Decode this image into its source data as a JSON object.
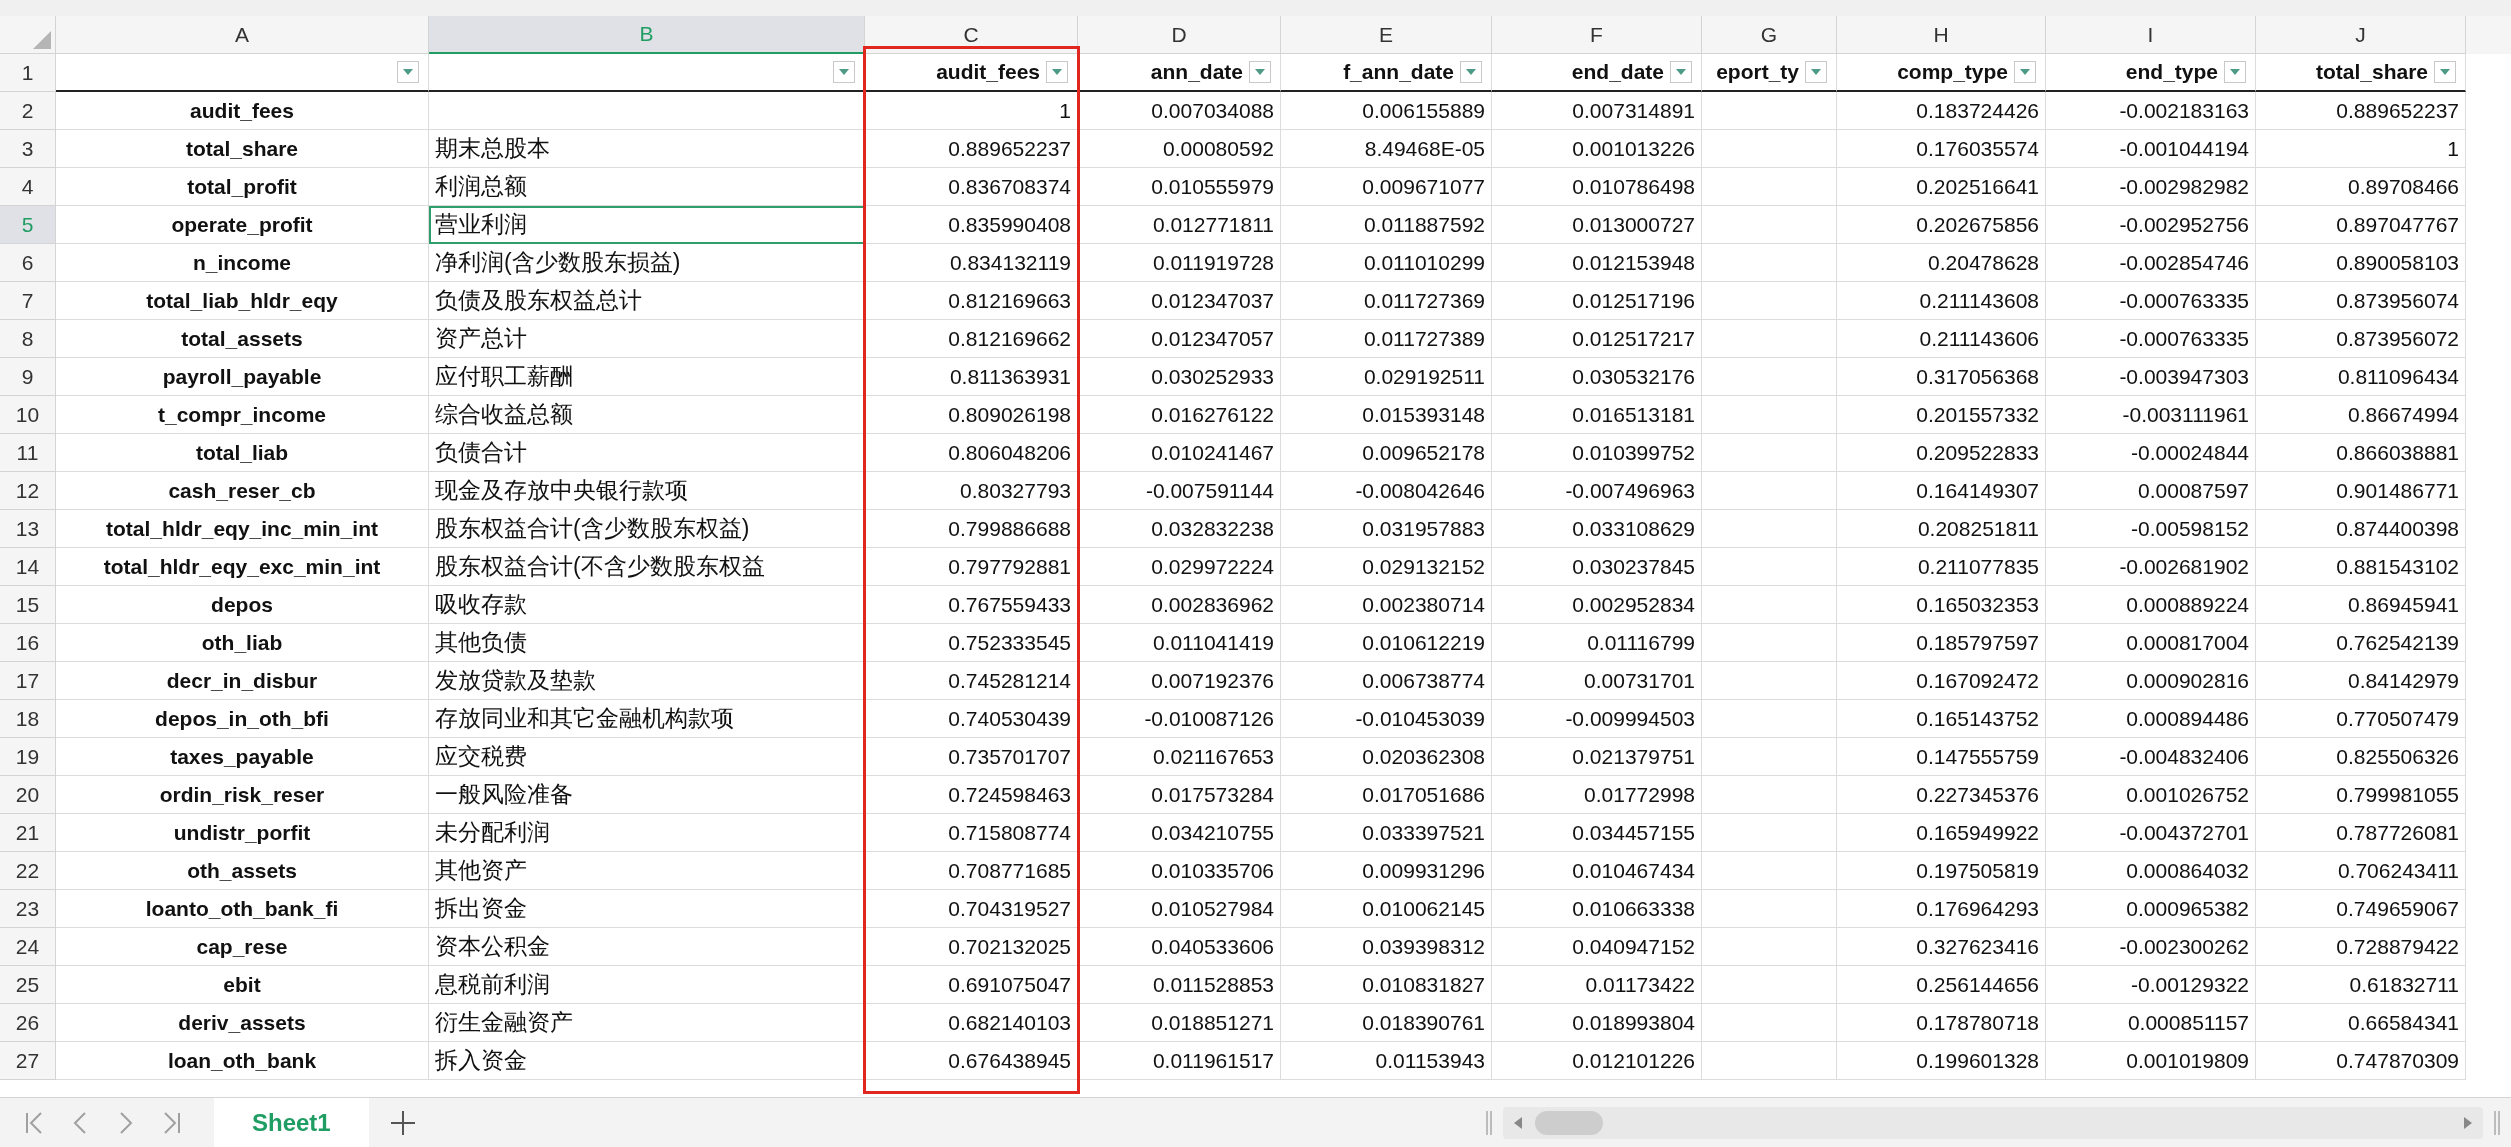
{
  "columns": [
    {
      "letter": "A",
      "selected": false
    },
    {
      "letter": "B",
      "selected": true
    },
    {
      "letter": "C",
      "selected": false
    },
    {
      "letter": "D",
      "selected": false
    },
    {
      "letter": "E",
      "selected": false
    },
    {
      "letter": "F",
      "selected": false
    },
    {
      "letter": "G",
      "selected": false
    },
    {
      "letter": "H",
      "selected": false
    },
    {
      "letter": "I",
      "selected": false
    },
    {
      "letter": "J",
      "selected": false
    }
  ],
  "header_row": {
    "number": "1",
    "selected": false,
    "cells": {
      "C": "audit_fees",
      "D": "ann_date",
      "E": "f_ann_date",
      "F": "end_date",
      "G": "eport_ty",
      "H": "comp_type",
      "I": "end_type",
      "J": "total_share"
    }
  },
  "rows": [
    {
      "number": "2",
      "selected": false,
      "cells": {
        "A": "audit_fees",
        "C": "1",
        "D": "0.007034088",
        "E": "0.006155889",
        "F": "0.007314891",
        "H": "0.183724426",
        "I": "-0.002183163",
        "J": "0.889652237"
      }
    },
    {
      "number": "3",
      "selected": false,
      "cells": {
        "A": "total_share",
        "B": "期末总股本",
        "C": "0.889652237",
        "D": "0.00080592",
        "E": "8.49468E-05",
        "F": "0.001013226",
        "H": "0.176035574",
        "I": "-0.001044194",
        "J": "1"
      }
    },
    {
      "number": "4",
      "selected": false,
      "cells": {
        "A": "total_profit",
        "B": "利润总额",
        "C": "0.836708374",
        "D": "0.010555979",
        "E": "0.009671077",
        "F": "0.010786498",
        "H": "0.202516641",
        "I": "-0.002982982",
        "J": "0.89708466"
      }
    },
    {
      "number": "5",
      "selected": true,
      "cells": {
        "A": "operate_profit",
        "B": "营业利润",
        "C": "0.835990408",
        "D": "0.012771811",
        "E": "0.011887592",
        "F": "0.013000727",
        "H": "0.202675856",
        "I": "-0.002952756",
        "J": "0.897047767"
      }
    },
    {
      "number": "6",
      "selected": false,
      "cells": {
        "A": "n_income",
        "B": "净利润(含少数股东损益)",
        "C": "0.834132119",
        "D": "0.011919728",
        "E": "0.011010299",
        "F": "0.012153948",
        "H": "0.20478628",
        "I": "-0.002854746",
        "J": "0.890058103"
      }
    },
    {
      "number": "7",
      "selected": false,
      "cells": {
        "A": "total_liab_hldr_eqy",
        "B": "负债及股东权益总计",
        "C": "0.812169663",
        "D": "0.012347037",
        "E": "0.011727369",
        "F": "0.012517196",
        "H": "0.211143608",
        "I": "-0.000763335",
        "J": "0.873956074"
      }
    },
    {
      "number": "8",
      "selected": false,
      "cells": {
        "A": "total_assets",
        "B": "资产总计",
        "C": "0.812169662",
        "D": "0.012347057",
        "E": "0.011727389",
        "F": "0.012517217",
        "H": "0.211143606",
        "I": "-0.000763335",
        "J": "0.873956072"
      }
    },
    {
      "number": "9",
      "selected": false,
      "cells": {
        "A": "payroll_payable",
        "B": "应付职工薪酬",
        "C": "0.811363931",
        "D": "0.030252933",
        "E": "0.029192511",
        "F": "0.030532176",
        "H": "0.317056368",
        "I": "-0.003947303",
        "J": "0.811096434"
      }
    },
    {
      "number": "10",
      "selected": false,
      "cells": {
        "A": "t_compr_income",
        "B": "综合收益总额",
        "C": "0.809026198",
        "D": "0.016276122",
        "E": "0.015393148",
        "F": "0.016513181",
        "H": "0.201557332",
        "I": "-0.003111961",
        "J": "0.86674994"
      }
    },
    {
      "number": "11",
      "selected": false,
      "cells": {
        "A": "total_liab",
        "B": "负债合计",
        "C": "0.806048206",
        "D": "0.010241467",
        "E": "0.009652178",
        "F": "0.010399752",
        "H": "0.209522833",
        "I": "-0.00024844",
        "J": "0.866038881"
      }
    },
    {
      "number": "12",
      "selected": false,
      "cells": {
        "A": "cash_reser_cb",
        "B": "现金及存放中央银行款项",
        "C": "0.80327793",
        "D": "-0.007591144",
        "E": "-0.008042646",
        "F": "-0.007496963",
        "H": "0.164149307",
        "I": "0.00087597",
        "J": "0.901486771"
      }
    },
    {
      "number": "13",
      "selected": false,
      "cells": {
        "A": "total_hldr_eqy_inc_min_int",
        "B": "股东权益合计(含少数股东权益)",
        "C": "0.799886688",
        "D": "0.032832238",
        "E": "0.031957883",
        "F": "0.033108629",
        "H": "0.208251811",
        "I": "-0.00598152",
        "J": "0.874400398"
      }
    },
    {
      "number": "14",
      "selected": false,
      "cells": {
        "A": "total_hldr_eqy_exc_min_int",
        "B": "股东权益合计(不含少数股东权益",
        "C": "0.797792881",
        "D": "0.029972224",
        "E": "0.029132152",
        "F": "0.030237845",
        "H": "0.211077835",
        "I": "-0.002681902",
        "J": "0.881543102"
      }
    },
    {
      "number": "15",
      "selected": false,
      "cells": {
        "A": "depos",
        "B": "吸收存款",
        "C": "0.767559433",
        "D": "0.002836962",
        "E": "0.002380714",
        "F": "0.002952834",
        "H": "0.165032353",
        "I": "0.000889224",
        "J": "0.86945941"
      }
    },
    {
      "number": "16",
      "selected": false,
      "cells": {
        "A": "oth_liab",
        "B": "其他负债",
        "C": "0.752333545",
        "D": "0.011041419",
        "E": "0.010612219",
        "F": "0.01116799",
        "H": "0.185797597",
        "I": "0.000817004",
        "J": "0.762542139"
      }
    },
    {
      "number": "17",
      "selected": false,
      "cells": {
        "A": "decr_in_disbur",
        "B": "发放贷款及垫款",
        "C": "0.745281214",
        "D": "0.007192376",
        "E": "0.006738774",
        "F": "0.00731701",
        "H": "0.167092472",
        "I": "0.000902816",
        "J": "0.84142979"
      }
    },
    {
      "number": "18",
      "selected": false,
      "cells": {
        "A": "depos_in_oth_bfi",
        "B": "存放同业和其它金融机构款项",
        "C": "0.740530439",
        "D": "-0.010087126",
        "E": "-0.010453039",
        "F": "-0.009994503",
        "H": "0.165143752",
        "I": "0.000894486",
        "J": "0.770507479"
      }
    },
    {
      "number": "19",
      "selected": false,
      "cells": {
        "A": "taxes_payable",
        "B": "应交税费",
        "C": "0.735701707",
        "D": "0.021167653",
        "E": "0.020362308",
        "F": "0.021379751",
        "H": "0.147555759",
        "I": "-0.004832406",
        "J": "0.825506326"
      }
    },
    {
      "number": "20",
      "selected": false,
      "cells": {
        "A": "ordin_risk_reser",
        "B": "一般风险准备",
        "C": "0.724598463",
        "D": "0.017573284",
        "E": "0.017051686",
        "F": "0.01772998",
        "H": "0.227345376",
        "I": "0.001026752",
        "J": "0.799981055"
      }
    },
    {
      "number": "21",
      "selected": false,
      "cells": {
        "A": "undistr_porfit",
        "B": "未分配利润",
        "C": "0.715808774",
        "D": "0.034210755",
        "E": "0.033397521",
        "F": "0.034457155",
        "H": "0.165949922",
        "I": "-0.004372701",
        "J": "0.787726081"
      }
    },
    {
      "number": "22",
      "selected": false,
      "cells": {
        "A": "oth_assets",
        "B": "其他资产",
        "C": "0.708771685",
        "D": "0.010335706",
        "E": "0.009931296",
        "F": "0.010467434",
        "H": "0.197505819",
        "I": "0.000864032",
        "J": "0.706243411"
      }
    },
    {
      "number": "23",
      "selected": false,
      "cells": {
        "A": "loanto_oth_bank_fi",
        "B": "拆出资金",
        "C": "0.704319527",
        "D": "0.010527984",
        "E": "0.010062145",
        "F": "0.010663338",
        "H": "0.176964293",
        "I": "0.000965382",
        "J": "0.749659067"
      }
    },
    {
      "number": "24",
      "selected": false,
      "cells": {
        "A": "cap_rese",
        "B": "资本公积金",
        "C": "0.702132025",
        "D": "0.040533606",
        "E": "0.039398312",
        "F": "0.040947152",
        "H": "0.327623416",
        "I": "-0.002300262",
        "J": "0.728879422"
      }
    },
    {
      "number": "25",
      "selected": false,
      "cells": {
        "A": "ebit",
        "B": "息税前利润",
        "C": "0.691075047",
        "D": "0.011528853",
        "E": "0.010831827",
        "F": "0.01173422",
        "H": "0.256144656",
        "I": "-0.00129322",
        "J": "0.61832711"
      }
    },
    {
      "number": "26",
      "selected": false,
      "cells": {
        "A": "deriv_assets",
        "B": "衍生金融资产",
        "C": "0.682140103",
        "D": "0.018851271",
        "E": "0.018390761",
        "F": "0.018993804",
        "H": "0.178780718",
        "I": "0.000851157",
        "J": "0.66584341"
      }
    },
    {
      "number": "27",
      "selected": false,
      "cells": {
        "A": "loan_oth_bank",
        "B": "拆入资金",
        "C": "0.676438945",
        "D": "0.011961517",
        "E": "0.01153943",
        "F": "0.012101226",
        "H": "0.199601328",
        "I": "0.001019809",
        "J": "0.747870309"
      }
    }
  ],
  "sheets": [
    {
      "name": "Sheet1",
      "selected": true
    }
  ]
}
